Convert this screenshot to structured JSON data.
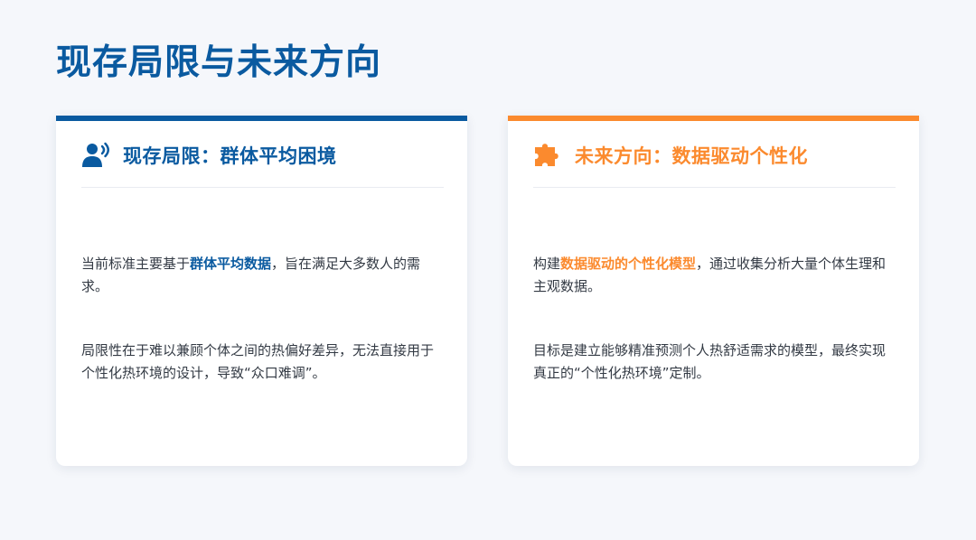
{
  "title": "现存局限与未来方向",
  "left_card": {
    "icon": "user-voice-icon",
    "title": "现存局限：群体平均困境",
    "p1": {
      "before": "当前标准主要基于",
      "highlight": "群体平均数据",
      "after": "，旨在满足大多数人的需求。"
    },
    "p2": "局限性在于难以兼顾个体之间的热偏好差异，无法直接用于个性化热环境的设计，导致“众口难调”。"
  },
  "right_card": {
    "icon": "puzzle-piece-icon",
    "title": "未来方向：数据驱动个性化",
    "p1": {
      "before": "构建",
      "highlight": "数据驱动的个性化模型",
      "after": "，通过收集分析大量个体生理和主观数据。"
    },
    "p2": "目标是建立能够精准预测个人热舒适需求的模型，最终实现真正的“个性化热环境”定制。"
  },
  "colors": {
    "primary_blue": "#0a5aa0",
    "accent_orange": "#fb8a2e",
    "background": "#f5f7fb",
    "body_text": "#333a44"
  }
}
